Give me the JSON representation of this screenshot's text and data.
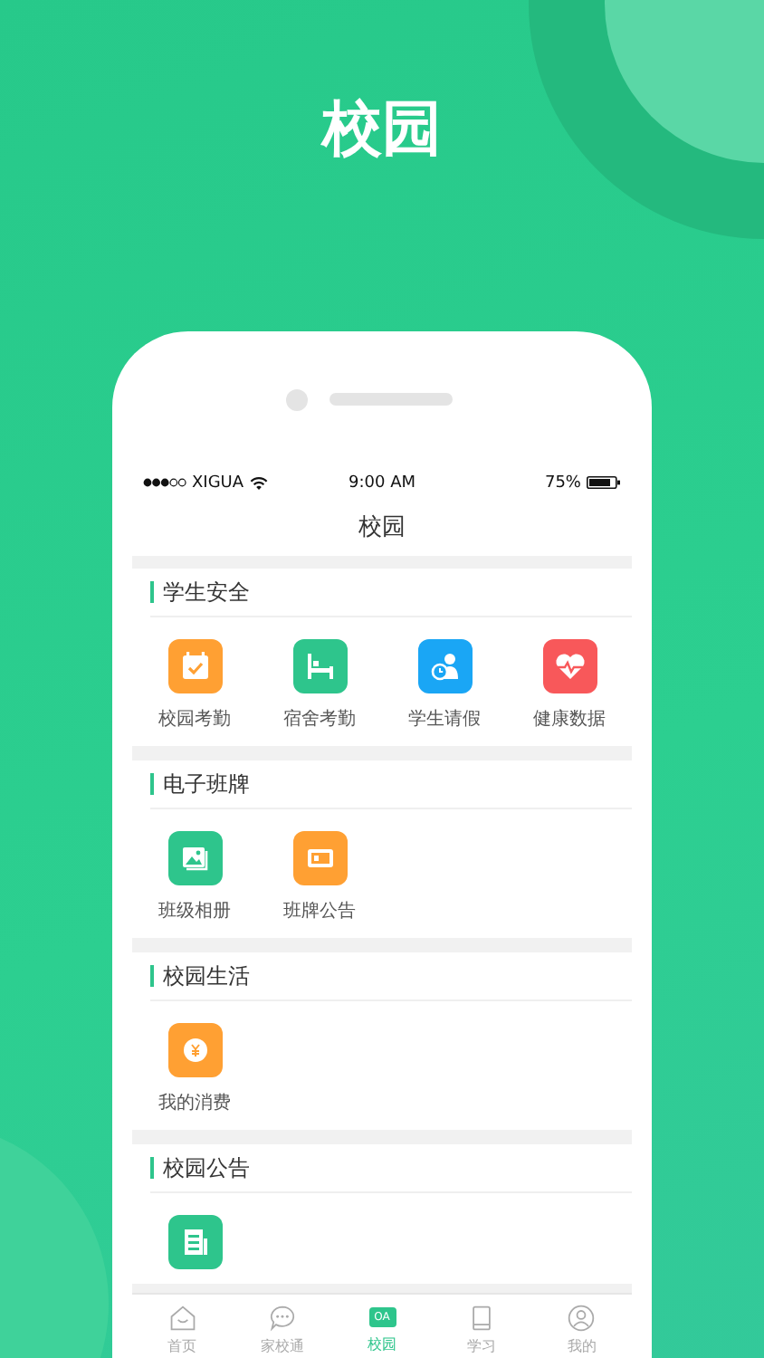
{
  "headline": "校园",
  "status_bar": {
    "carrier": "XIGUA",
    "time": "9:00 AM",
    "battery": "75%"
  },
  "nav": {
    "title": "校园"
  },
  "sections": [
    {
      "title": "学生安全",
      "items": [
        {
          "label": "校园考勤",
          "color": "#ffa033"
        },
        {
          "label": "宿舍考勤",
          "color": "#2ec58c"
        },
        {
          "label": "学生请假",
          "color": "#1aa6f5"
        },
        {
          "label": "健康数据",
          "color": "#f8585a"
        }
      ]
    },
    {
      "title": "电子班牌",
      "items": [
        {
          "label": "班级相册",
          "color": "#2ec58c"
        },
        {
          "label": "班牌公告",
          "color": "#ffa033"
        }
      ]
    },
    {
      "title": "校园生活",
      "items": [
        {
          "label": "我的消费",
          "color": "#ffa033"
        }
      ]
    },
    {
      "title": "校园公告",
      "items": [
        {
          "color": "#2ec58c"
        }
      ]
    }
  ],
  "tabs": [
    {
      "label": "首页",
      "selected": false
    },
    {
      "label": "家校通",
      "selected": false
    },
    {
      "label": "校园",
      "selected": true,
      "icon_text": "OA"
    },
    {
      "label": "学习",
      "selected": false
    },
    {
      "label": "我的",
      "selected": false
    }
  ]
}
